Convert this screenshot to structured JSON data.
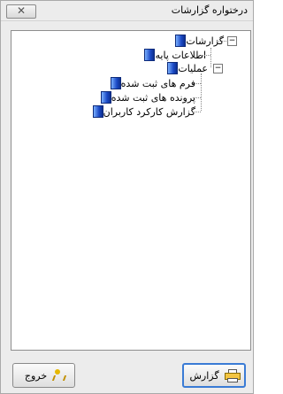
{
  "window": {
    "title": "درختواره گزارشات",
    "close_symbol": "✕"
  },
  "tree": {
    "root": {
      "label": "گزارشات",
      "expander": "−"
    },
    "children": [
      {
        "label": "اطلاعات پایه"
      },
      {
        "label": "عملیات",
        "expander": "−",
        "children": [
          {
            "label": "فرم های ثبت شده"
          },
          {
            "label": "پرونده های ثبت شده"
          },
          {
            "label": "گزارش کارکرد کاربران"
          }
        ]
      }
    ]
  },
  "buttons": {
    "exit": "خروج",
    "report": "گزارش"
  },
  "icons": {
    "node": "book-icon",
    "exit": "exit-person-icon",
    "report": "printer-icon"
  }
}
